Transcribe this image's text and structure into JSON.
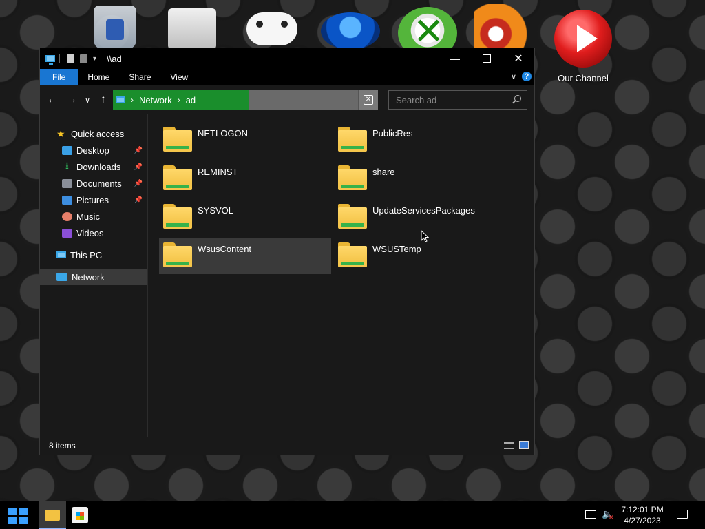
{
  "desktop": {
    "icons": [
      {
        "id": "recycle-bin"
      },
      {
        "id": "folders"
      },
      {
        "id": "xbox-controller"
      },
      {
        "id": "steam"
      },
      {
        "id": "xbox"
      },
      {
        "id": "bird-logo"
      }
    ],
    "channel_label": "Our Channel"
  },
  "window": {
    "title": "\\\\ad",
    "controls": {
      "minimize": "—",
      "close": "✕"
    },
    "ribbon_tabs": [
      "File",
      "Home",
      "Share",
      "View"
    ],
    "help": "?",
    "nav": {
      "back": "←",
      "forward": "→",
      "recent": "∨",
      "up": "↑"
    },
    "address": {
      "crumbs": [
        "Network",
        "ad"
      ],
      "separator": "›",
      "clear_symbol": "✕"
    },
    "search": {
      "placeholder": "Search ad"
    },
    "sidebar": {
      "quick_access": "Quick access",
      "items": [
        {
          "label": "Desktop",
          "pinned": true,
          "icon": "desktop-icon"
        },
        {
          "label": "Downloads",
          "pinned": true,
          "icon": "download-icon"
        },
        {
          "label": "Documents",
          "pinned": true,
          "icon": "documents-icon"
        },
        {
          "label": "Pictures",
          "pinned": true,
          "icon": "pictures-icon"
        },
        {
          "label": "Music",
          "pinned": false,
          "icon": "music-icon"
        },
        {
          "label": "Videos",
          "pinned": false,
          "icon": "videos-icon"
        }
      ],
      "this_pc": "This PC",
      "network": "Network",
      "pin_symbol": "📌"
    },
    "folders": [
      {
        "name": "NETLOGON"
      },
      {
        "name": "PublicRes"
      },
      {
        "name": "REMINST"
      },
      {
        "name": "share"
      },
      {
        "name": "SYSVOL"
      },
      {
        "name": "UpdateServicesPackages"
      },
      {
        "name": "WsusContent"
      },
      {
        "name": "WSUSTemp"
      }
    ],
    "status": "8 items"
  },
  "taskbar": {
    "time": "7:12:01 PM",
    "date": "4/27/2023",
    "volume_symbol": "🔈",
    "volume_muted_symbol": "✕"
  },
  "colors": {
    "accent": "#1976d2",
    "address_highlight": "#1a8e2c",
    "folder": "#f5c64c",
    "folder_stripe": "#36b24a"
  }
}
